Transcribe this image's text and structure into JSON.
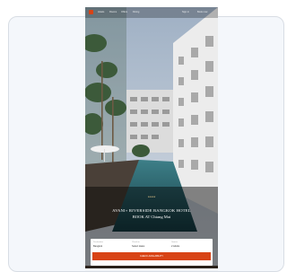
{
  "nav": {
    "logo_icon": "brand-logo-icon",
    "items": [
      "Hotels",
      "Rooms",
      "Offers",
      "Dining"
    ],
    "right_items": [
      "Sign in",
      "Book now"
    ]
  },
  "hero": {
    "subtitle": "★★★★",
    "title_line1": "AVANI+ RIVERSIDE BANGKOK HOTEL",
    "title_line2": "BOOK AT Chiang Mai"
  },
  "booking": {
    "fields": [
      {
        "label": "Destination",
        "value": "Bangkok"
      },
      {
        "label": "Check-in",
        "value": "Select dates"
      },
      {
        "label": "Guests",
        "value": "2 Adults"
      }
    ],
    "button_label": "CHECK AVAILABILITY"
  },
  "colors": {
    "accent": "#d84315",
    "pool": "#2f6f7a",
    "building": "#e7e7e7"
  }
}
